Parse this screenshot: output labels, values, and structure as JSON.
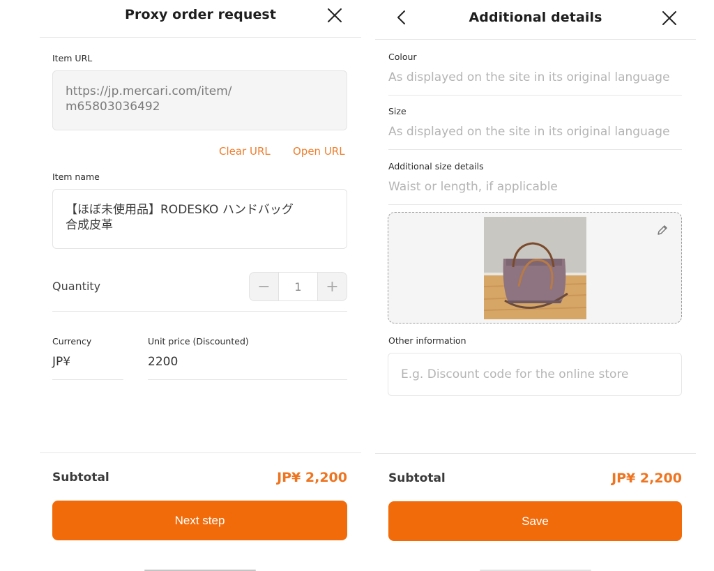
{
  "left": {
    "header": {
      "title": "Proxy order request",
      "close_icon": "close-icon"
    },
    "item_url": {
      "label": "Item URL",
      "value_line1": "https://jp.mercari.com/item/",
      "value_line2": "m65803036492"
    },
    "url_actions": {
      "clear": "Clear URL",
      "open": "Open URL"
    },
    "item_name": {
      "label": "Item name",
      "value_line1": "【ほぼ未使用品】RODESKO ハンドバッグ",
      "value_line2": "合成皮革"
    },
    "quantity": {
      "label": "Quantity",
      "value": "1",
      "minus": "−",
      "plus": "+"
    },
    "currency": {
      "label": "Currency",
      "value": "JP¥"
    },
    "unit_price": {
      "label": "Unit price (Discounted)",
      "value": "2200"
    },
    "subtotal": {
      "label": "Subtotal",
      "value": "JP¥ 2,200"
    },
    "primary_button": "Next step"
  },
  "right": {
    "header": {
      "title": "Additional details",
      "back_icon": "chevron-left-icon",
      "close_icon": "close-icon"
    },
    "colour": {
      "label": "Colour",
      "placeholder": "As displayed on the site in its original language"
    },
    "size": {
      "label": "Size",
      "placeholder": "As displayed on the site in its original language"
    },
    "additional_size": {
      "label": "Additional size details",
      "placeholder": "Waist or length, if applicable"
    },
    "photo": {
      "description": "Photo of a mauve leather handbag on a wooden floor",
      "edit_icon": "pencil-icon"
    },
    "other_info": {
      "label": "Other information",
      "placeholder": "E.g. Discount code for the online store"
    },
    "subtotal": {
      "label": "Subtotal",
      "value": "JP¥ 2,200"
    },
    "primary_button": "Save"
  },
  "colors": {
    "accent": "#f26b0a",
    "accent_text": "#ee7420",
    "link": "#ee7f2f"
  }
}
